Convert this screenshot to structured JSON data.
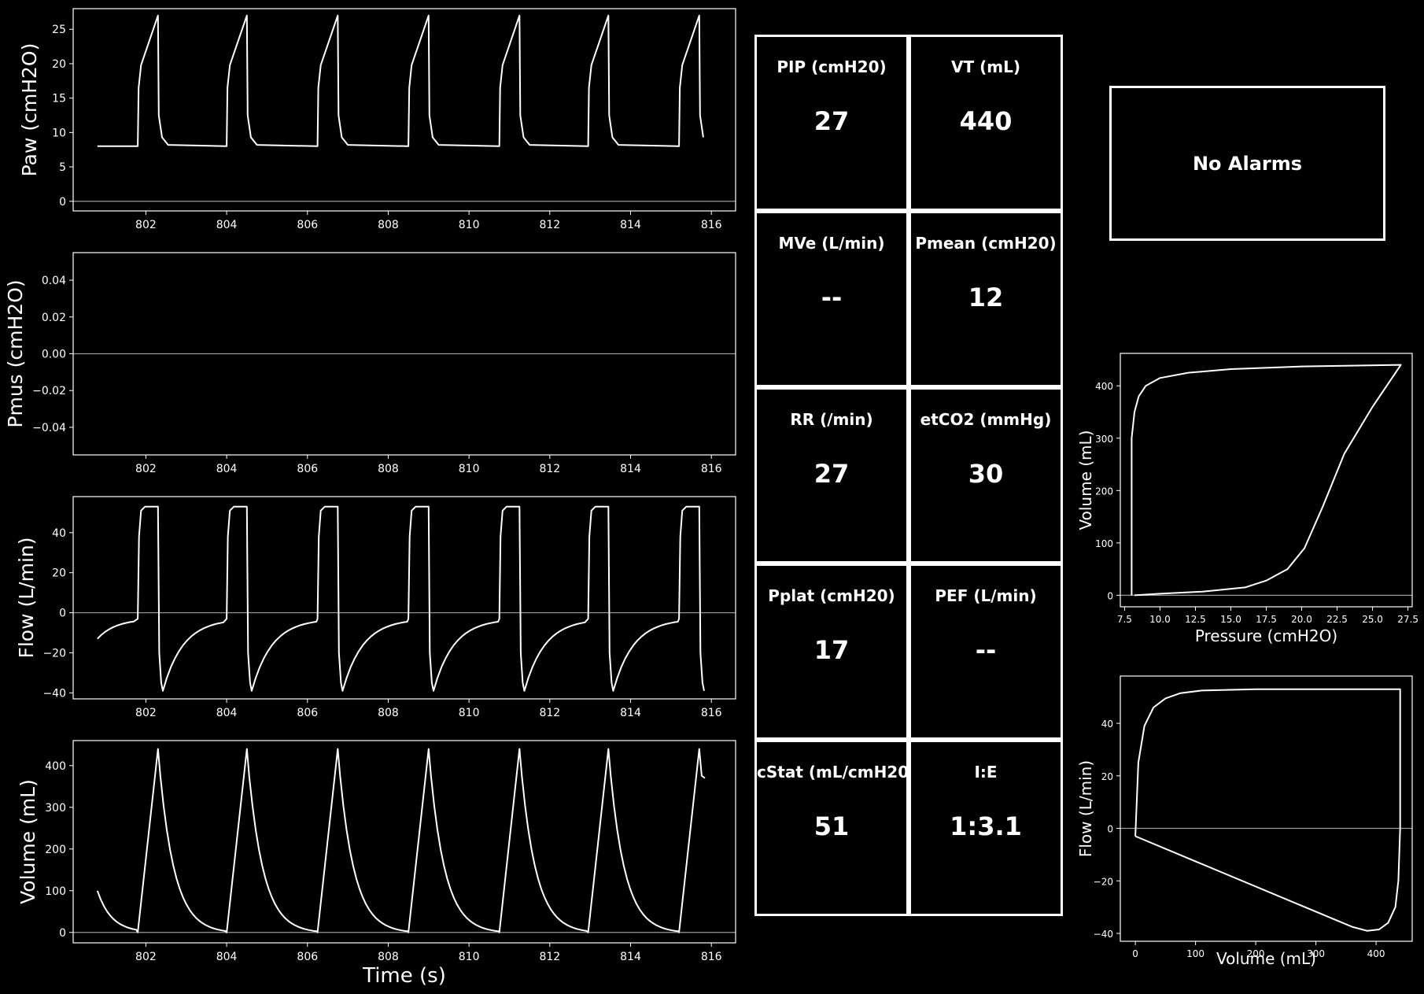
{
  "chart_data": [
    {
      "type": "line",
      "id": "paw",
      "ylabel": "Paw (cmH2O)",
      "xlabel": "",
      "xlim": [
        800.2,
        816.6
      ],
      "ylim": [
        -1.4,
        28.0
      ],
      "xticks": [
        "802",
        "804",
        "806",
        "808",
        "810",
        "812",
        "814",
        "816"
      ],
      "yticks": [
        "0",
        "5",
        "10",
        "15",
        "20",
        "25"
      ],
      "cycle_starts": [
        801.8,
        804.0,
        806.25,
        808.5,
        810.75,
        812.95,
        815.2
      ],
      "series": [
        {
          "points": [
            [
              800.8,
              8.0
            ],
            [
              815.85,
              8.3
            ]
          ]
        }
      ],
      "breath_shape": {
        "peak": 27.0,
        "baseline": 8.0
      }
    },
    {
      "type": "line",
      "id": "pmus",
      "ylabel": "Pmus (cmH2O)",
      "xlabel": "",
      "xlim": [
        800.2,
        816.6
      ],
      "ylim": [
        -0.055,
        0.055
      ],
      "xticks": [
        "802",
        "804",
        "806",
        "808",
        "810",
        "812",
        "814",
        "816"
      ],
      "yticks": [
        "−0.04",
        "−0.02",
        "0.00",
        "0.02",
        "0.04"
      ],
      "series": [
        {
          "points": [
            [
              800.8,
              0.0
            ],
            [
              815.85,
              0.0
            ]
          ]
        }
      ]
    },
    {
      "type": "line",
      "id": "flow",
      "ylabel": "Flow (L/min)",
      "xlabel": "",
      "xlim": [
        800.2,
        816.6
      ],
      "ylim": [
        -43.0,
        58.0
      ],
      "xticks": [
        "802",
        "804",
        "806",
        "808",
        "810",
        "812",
        "814",
        "816"
      ],
      "yticks": [
        "−40",
        "−20",
        "0",
        "20",
        "40"
      ],
      "cycle_starts": [
        801.8,
        804.0,
        806.25,
        808.5,
        810.75,
        812.95,
        815.2
      ],
      "breath_shape": {
        "peak": 53.0,
        "trough": -39.0,
        "end_exp": -3.0
      }
    },
    {
      "type": "line",
      "id": "volume",
      "ylabel": "Volume (mL)",
      "xlabel": "Time (s)",
      "xlim": [
        800.2,
        816.6
      ],
      "ylim": [
        -25,
        460
      ],
      "xticks": [
        "802",
        "804",
        "806",
        "808",
        "810",
        "812",
        "814",
        "816"
      ],
      "yticks": [
        "0",
        "100",
        "200",
        "300",
        "400"
      ],
      "cycle_starts": [
        801.8,
        804.0,
        806.25,
        808.5,
        810.75,
        812.95,
        815.2
      ],
      "breath_shape": {
        "peak": 440.0
      }
    },
    {
      "type": "line",
      "id": "pv-loop",
      "xlabel": "Pressure (cmH2O)",
      "ylabel": "Volume (mL)",
      "xlim": [
        7.2,
        27.8
      ],
      "ylim": [
        -22,
        462
      ],
      "xticks": [
        "7.5",
        "10.0",
        "12.5",
        "15.0",
        "17.5",
        "20.0",
        "22.5",
        "25.0",
        "27.5"
      ],
      "yticks": [
        "0",
        "100",
        "200",
        "300",
        "400"
      ],
      "series": [
        {
          "points": [
            [
              8.0,
              0
            ],
            [
              8.0,
              300
            ],
            [
              8.2,
              350
            ],
            [
              8.5,
              380
            ],
            [
              9.0,
              400
            ],
            [
              10.0,
              415
            ],
            [
              12.0,
              425
            ],
            [
              15.0,
              432
            ],
            [
              20.0,
              437
            ],
            [
              27.0,
              440
            ],
            [
              25.0,
              360
            ],
            [
              23.0,
              270
            ],
            [
              21.5,
              170
            ],
            [
              20.2,
              90
            ],
            [
              19.0,
              50
            ],
            [
              17.5,
              28
            ],
            [
              16.0,
              15
            ],
            [
              13.0,
              7
            ],
            [
              10.0,
              3
            ],
            [
              8.2,
              0
            ]
          ]
        }
      ]
    },
    {
      "type": "line",
      "id": "fv-loop",
      "xlabel": "Volume (mL)",
      "ylabel": "Flow (L/min)",
      "xlim": [
        -25,
        460
      ],
      "ylim": [
        -43.0,
        58.0
      ],
      "xticks": [
        "0",
        "100",
        "200",
        "300",
        "400"
      ],
      "yticks": [
        "−40",
        "−20",
        "0",
        "20",
        "40"
      ],
      "series": [
        {
          "points": [
            [
              0,
              -3
            ],
            [
              5,
              25
            ],
            [
              15,
              39
            ],
            [
              30,
              46
            ],
            [
              50,
              49.5
            ],
            [
              75,
              51.5
            ],
            [
              110,
              52.5
            ],
            [
              200,
              53
            ],
            [
              440,
              53
            ],
            [
              440,
              0
            ],
            [
              437,
              -20
            ],
            [
              432,
              -30
            ],
            [
              420,
              -36
            ],
            [
              405,
              -38.5
            ],
            [
              385,
              -39
            ],
            [
              360,
              -37.5
            ],
            [
              0,
              -3
            ]
          ]
        }
      ]
    }
  ],
  "metrics": [
    {
      "label": "PIP (cmH20)",
      "value": "27"
    },
    {
      "label": "VT (mL)",
      "value": "440"
    },
    {
      "label": "MVe (L/min)",
      "value": "--"
    },
    {
      "label": "Pmean (cmH20)",
      "value": "12"
    },
    {
      "label": "RR (/min)",
      "value": "27"
    },
    {
      "label": "etCO2 (mmHg)",
      "value": "30"
    },
    {
      "label": "Pplat (cmH20)",
      "value": "17"
    },
    {
      "label": "PEF (L/min)",
      "value": "--"
    },
    {
      "label": "cStat (mL/cmH20)",
      "value": "51"
    },
    {
      "label": "I:E",
      "value": "1:3.1"
    }
  ],
  "alarm": {
    "text": "No Alarms"
  }
}
